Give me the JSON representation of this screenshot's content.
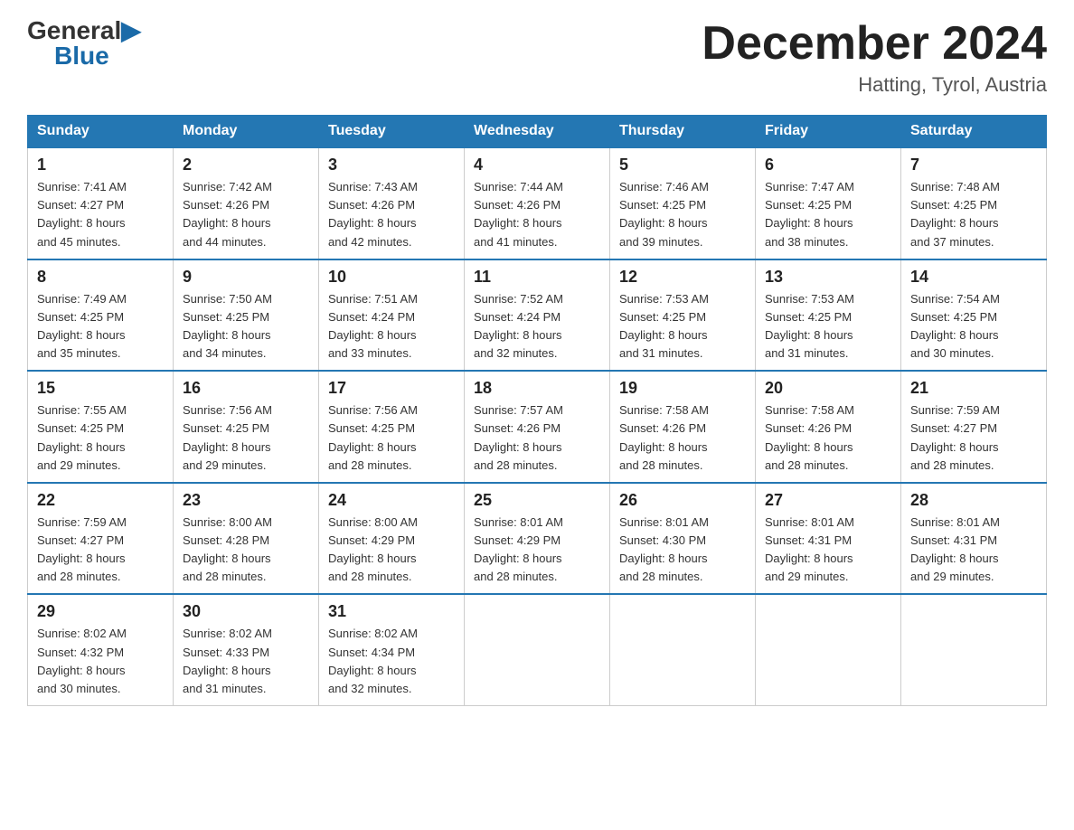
{
  "header": {
    "logo_general": "General",
    "logo_blue": "Blue",
    "month_title": "December 2024",
    "location": "Hatting, Tyrol, Austria"
  },
  "days_of_week": [
    "Sunday",
    "Monday",
    "Tuesday",
    "Wednesday",
    "Thursday",
    "Friday",
    "Saturday"
  ],
  "weeks": [
    [
      {
        "num": "1",
        "sunrise": "7:41 AM",
        "sunset": "4:27 PM",
        "daylight": "8 hours and 45 minutes."
      },
      {
        "num": "2",
        "sunrise": "7:42 AM",
        "sunset": "4:26 PM",
        "daylight": "8 hours and 44 minutes."
      },
      {
        "num": "3",
        "sunrise": "7:43 AM",
        "sunset": "4:26 PM",
        "daylight": "8 hours and 42 minutes."
      },
      {
        "num": "4",
        "sunrise": "7:44 AM",
        "sunset": "4:26 PM",
        "daylight": "8 hours and 41 minutes."
      },
      {
        "num": "5",
        "sunrise": "7:46 AM",
        "sunset": "4:25 PM",
        "daylight": "8 hours and 39 minutes."
      },
      {
        "num": "6",
        "sunrise": "7:47 AM",
        "sunset": "4:25 PM",
        "daylight": "8 hours and 38 minutes."
      },
      {
        "num": "7",
        "sunrise": "7:48 AM",
        "sunset": "4:25 PM",
        "daylight": "8 hours and 37 minutes."
      }
    ],
    [
      {
        "num": "8",
        "sunrise": "7:49 AM",
        "sunset": "4:25 PM",
        "daylight": "8 hours and 35 minutes."
      },
      {
        "num": "9",
        "sunrise": "7:50 AM",
        "sunset": "4:25 PM",
        "daylight": "8 hours and 34 minutes."
      },
      {
        "num": "10",
        "sunrise": "7:51 AM",
        "sunset": "4:24 PM",
        "daylight": "8 hours and 33 minutes."
      },
      {
        "num": "11",
        "sunrise": "7:52 AM",
        "sunset": "4:24 PM",
        "daylight": "8 hours and 32 minutes."
      },
      {
        "num": "12",
        "sunrise": "7:53 AM",
        "sunset": "4:25 PM",
        "daylight": "8 hours and 31 minutes."
      },
      {
        "num": "13",
        "sunrise": "7:53 AM",
        "sunset": "4:25 PM",
        "daylight": "8 hours and 31 minutes."
      },
      {
        "num": "14",
        "sunrise": "7:54 AM",
        "sunset": "4:25 PM",
        "daylight": "8 hours and 30 minutes."
      }
    ],
    [
      {
        "num": "15",
        "sunrise": "7:55 AM",
        "sunset": "4:25 PM",
        "daylight": "8 hours and 29 minutes."
      },
      {
        "num": "16",
        "sunrise": "7:56 AM",
        "sunset": "4:25 PM",
        "daylight": "8 hours and 29 minutes."
      },
      {
        "num": "17",
        "sunrise": "7:56 AM",
        "sunset": "4:25 PM",
        "daylight": "8 hours and 28 minutes."
      },
      {
        "num": "18",
        "sunrise": "7:57 AM",
        "sunset": "4:26 PM",
        "daylight": "8 hours and 28 minutes."
      },
      {
        "num": "19",
        "sunrise": "7:58 AM",
        "sunset": "4:26 PM",
        "daylight": "8 hours and 28 minutes."
      },
      {
        "num": "20",
        "sunrise": "7:58 AM",
        "sunset": "4:26 PM",
        "daylight": "8 hours and 28 minutes."
      },
      {
        "num": "21",
        "sunrise": "7:59 AM",
        "sunset": "4:27 PM",
        "daylight": "8 hours and 28 minutes."
      }
    ],
    [
      {
        "num": "22",
        "sunrise": "7:59 AM",
        "sunset": "4:27 PM",
        "daylight": "8 hours and 28 minutes."
      },
      {
        "num": "23",
        "sunrise": "8:00 AM",
        "sunset": "4:28 PM",
        "daylight": "8 hours and 28 minutes."
      },
      {
        "num": "24",
        "sunrise": "8:00 AM",
        "sunset": "4:29 PM",
        "daylight": "8 hours and 28 minutes."
      },
      {
        "num": "25",
        "sunrise": "8:01 AM",
        "sunset": "4:29 PM",
        "daylight": "8 hours and 28 minutes."
      },
      {
        "num": "26",
        "sunrise": "8:01 AM",
        "sunset": "4:30 PM",
        "daylight": "8 hours and 28 minutes."
      },
      {
        "num": "27",
        "sunrise": "8:01 AM",
        "sunset": "4:31 PM",
        "daylight": "8 hours and 29 minutes."
      },
      {
        "num": "28",
        "sunrise": "8:01 AM",
        "sunset": "4:31 PM",
        "daylight": "8 hours and 29 minutes."
      }
    ],
    [
      {
        "num": "29",
        "sunrise": "8:02 AM",
        "sunset": "4:32 PM",
        "daylight": "8 hours and 30 minutes."
      },
      {
        "num": "30",
        "sunrise": "8:02 AM",
        "sunset": "4:33 PM",
        "daylight": "8 hours and 31 minutes."
      },
      {
        "num": "31",
        "sunrise": "8:02 AM",
        "sunset": "4:34 PM",
        "daylight": "8 hours and 32 minutes."
      },
      null,
      null,
      null,
      null
    ]
  ],
  "labels": {
    "sunrise": "Sunrise:",
    "sunset": "Sunset:",
    "daylight": "Daylight:"
  }
}
